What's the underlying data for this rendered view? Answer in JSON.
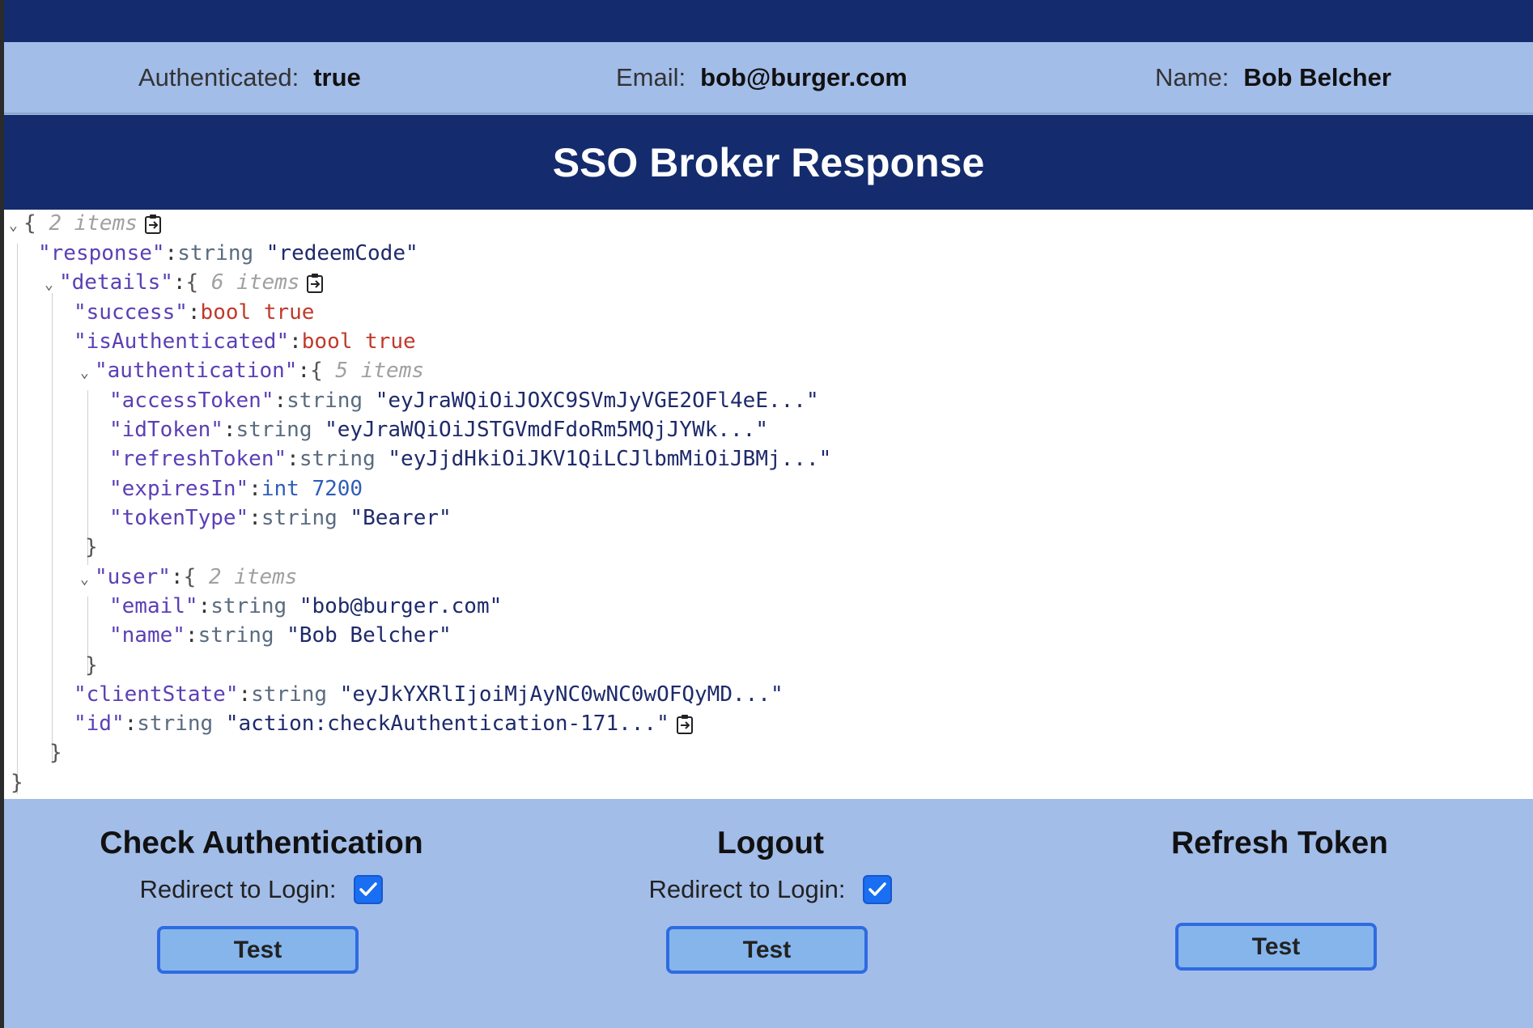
{
  "status": {
    "authenticated_label": "Authenticated:",
    "authenticated_value": "true",
    "email_label": "Email:",
    "email_value": "bob@burger.com",
    "name_label": "Name:",
    "name_value": "Bob Belcher"
  },
  "title": "SSO Broker Response",
  "json_view": {
    "root_count": "2 items",
    "response_key": "\"response\"",
    "response_type": "string",
    "response_value": "\"redeemCode\"",
    "details_key": "\"details\"",
    "details_count": "6 items",
    "success_key": "\"success\"",
    "success_type": "bool",
    "success_value": "true",
    "isauth_key": "\"isAuthenticated\"",
    "isauth_type": "bool",
    "isauth_value": "true",
    "authentication_key": "\"authentication\"",
    "authentication_count": "5 items",
    "access_key": "\"accessToken\"",
    "access_type": "string",
    "access_value": "\"eyJraWQiOiJOXC9SVmJyVGE2OFl4eE...\"",
    "id_token_key": "\"idToken\"",
    "id_token_type": "string",
    "id_token_value": "\"eyJraWQiOiJSTGVmdFdoRm5MQjJYWk...\"",
    "refresh_key": "\"refreshToken\"",
    "refresh_type": "string",
    "refresh_value": "\"eyJjdHkiOiJKV1QiLCJlbmMiOiJBMj...\"",
    "expires_key": "\"expiresIn\"",
    "expires_type": "int",
    "expires_value": "7200",
    "tokentype_key": "\"tokenType\"",
    "tokentype_type": "string",
    "tokentype_value": "\"Bearer\"",
    "user_key": "\"user\"",
    "user_count": "2 items",
    "email_key": "\"email\"",
    "email_type": "string",
    "email_value": "\"bob@burger.com\"",
    "name_key": "\"name\"",
    "name_type": "string",
    "name_value": "\"Bob Belcher\"",
    "clientstate_key": "\"clientState\"",
    "clientstate_type": "string",
    "clientstate_value": "\"eyJkYXRlIjoiMjAyNC0wNC0wOFQyMD...\"",
    "idfield_key": "\"id\"",
    "idfield_type": "string",
    "idfield_value": "\"action:checkAuthentication-171...\""
  },
  "actions": [
    {
      "title": "Check Authentication",
      "option_label": "Redirect to Login:",
      "checked": true,
      "button": "Test"
    },
    {
      "title": "Logout",
      "option_label": "Redirect to Login:",
      "checked": true,
      "button": "Test"
    },
    {
      "title": "Refresh Token",
      "button": "Test"
    }
  ],
  "colors": {
    "navy": "#142c6d",
    "panel_blue": "#a3bde9",
    "button_fill": "#86b5ec",
    "button_border": "#2e6be0",
    "checkbox": "#1a6ef2"
  },
  "icons": [
    "caret-down-icon",
    "clipboard-copy-icon",
    "checkmark-icon"
  ]
}
